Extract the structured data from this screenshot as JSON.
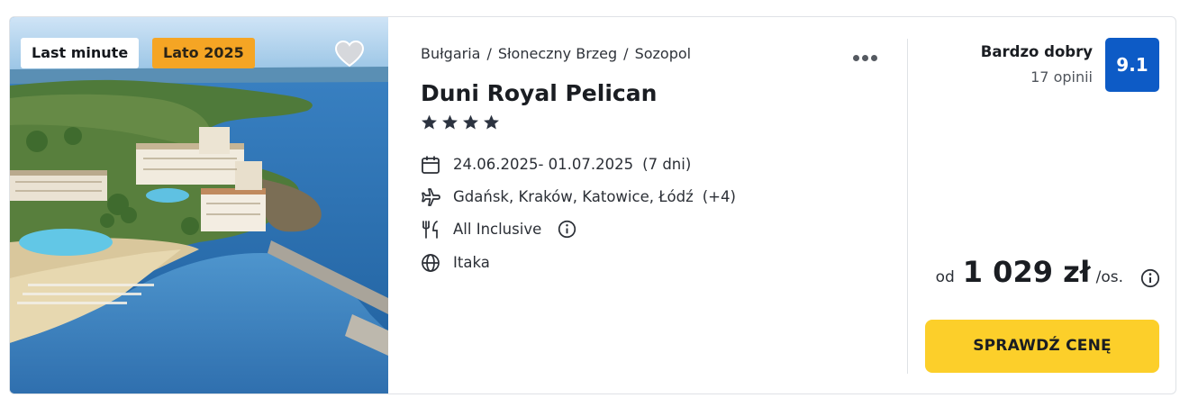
{
  "badges": {
    "last_minute": "Last minute",
    "season": "Lato 2025"
  },
  "offer": {
    "breadcrumb": [
      "Bułgaria",
      "Słoneczny Brzeg",
      "Sozopol"
    ],
    "breadcrumb_separator": "/",
    "hotel_name": "Duni Royal Pelican",
    "stars": 4,
    "dates": "24.06.2025- 01.07.2025",
    "duration": "(7 dni)",
    "airports": "Gdańsk, Kraków, Katowice, Łódź",
    "airports_more": "(+4)",
    "board": "All Inclusive",
    "operator": "Itaka",
    "icons": [
      "calendar-icon",
      "plane-icon",
      "cutlery-icon",
      "info-icon",
      "globe-icon",
      "more-dots-icon",
      "heart-icon"
    ]
  },
  "rating": {
    "label": "Bardzo dobry",
    "count": "17 opinii",
    "score": "9.1"
  },
  "price": {
    "prefix": "od",
    "value": "1 029 zł",
    "suffix": "/os."
  },
  "cta": {
    "label": "SPRAWDŹ CENĘ"
  },
  "colors": {
    "score_bg": "#0d5bc6",
    "cta_bg": "#fccf2a",
    "season_badge_bg": "#f5a524",
    "text": "#2b2f36",
    "border": "#dfe2e6"
  }
}
